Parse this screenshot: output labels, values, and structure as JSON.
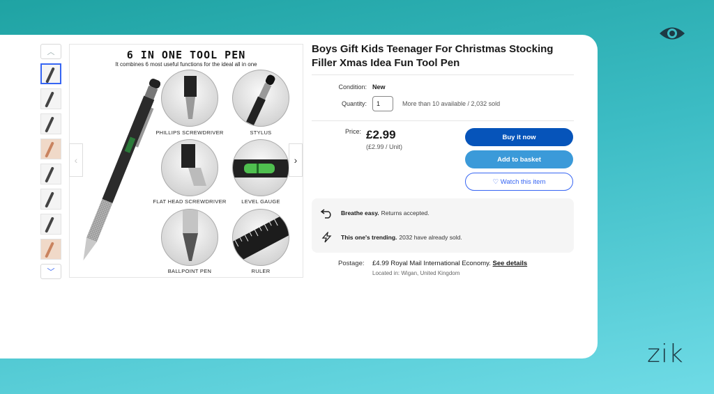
{
  "brand": {
    "name": "zik"
  },
  "gallery": {
    "thumb_count": 8,
    "image_title": "6 IN ONE TOOL PEN",
    "image_subtitle": "It combines 6 most useful functions for the ideal all in one",
    "features": [
      "PHILLIPS SCREWDRIVER",
      "STYLUS",
      "FLAT HEAD SCREWDRIVER",
      "LEVEL GAUGE",
      "BALLPOINT PEN",
      "RULER"
    ],
    "prev_icon": "chevron-left-icon",
    "next_icon": "chevron-right-icon"
  },
  "product": {
    "title": "Boys Gift Kids Teenager For Christmas Stocking Filler Xmas Idea Fun Tool Pen",
    "condition_label": "Condition:",
    "condition_value": "New",
    "quantity_label": "Quantity:",
    "quantity_value": "1",
    "availability": "More than 10 available / 2,032 sold",
    "price_label": "Price:",
    "price": "£2.99",
    "price_unit": "(£2.99 / Unit)"
  },
  "actions": {
    "buy_now": "Buy it now",
    "add_to_basket": "Add to basket",
    "watch": "♡ Watch this item"
  },
  "info": {
    "returns_bold": "Breathe easy.",
    "returns_text": "Returns accepted.",
    "trending_bold": "This one's trending.",
    "trending_text": "2032 have already sold."
  },
  "postage": {
    "label": "Postage:",
    "value": "£4.99 Royal Mail International Economy.",
    "link": "See details",
    "location": "Located in: Wigan, United Kingdom"
  },
  "colors": {
    "buy_button": "#0654ba",
    "basket_button": "#3b9ad9",
    "link": "#3665f3"
  }
}
